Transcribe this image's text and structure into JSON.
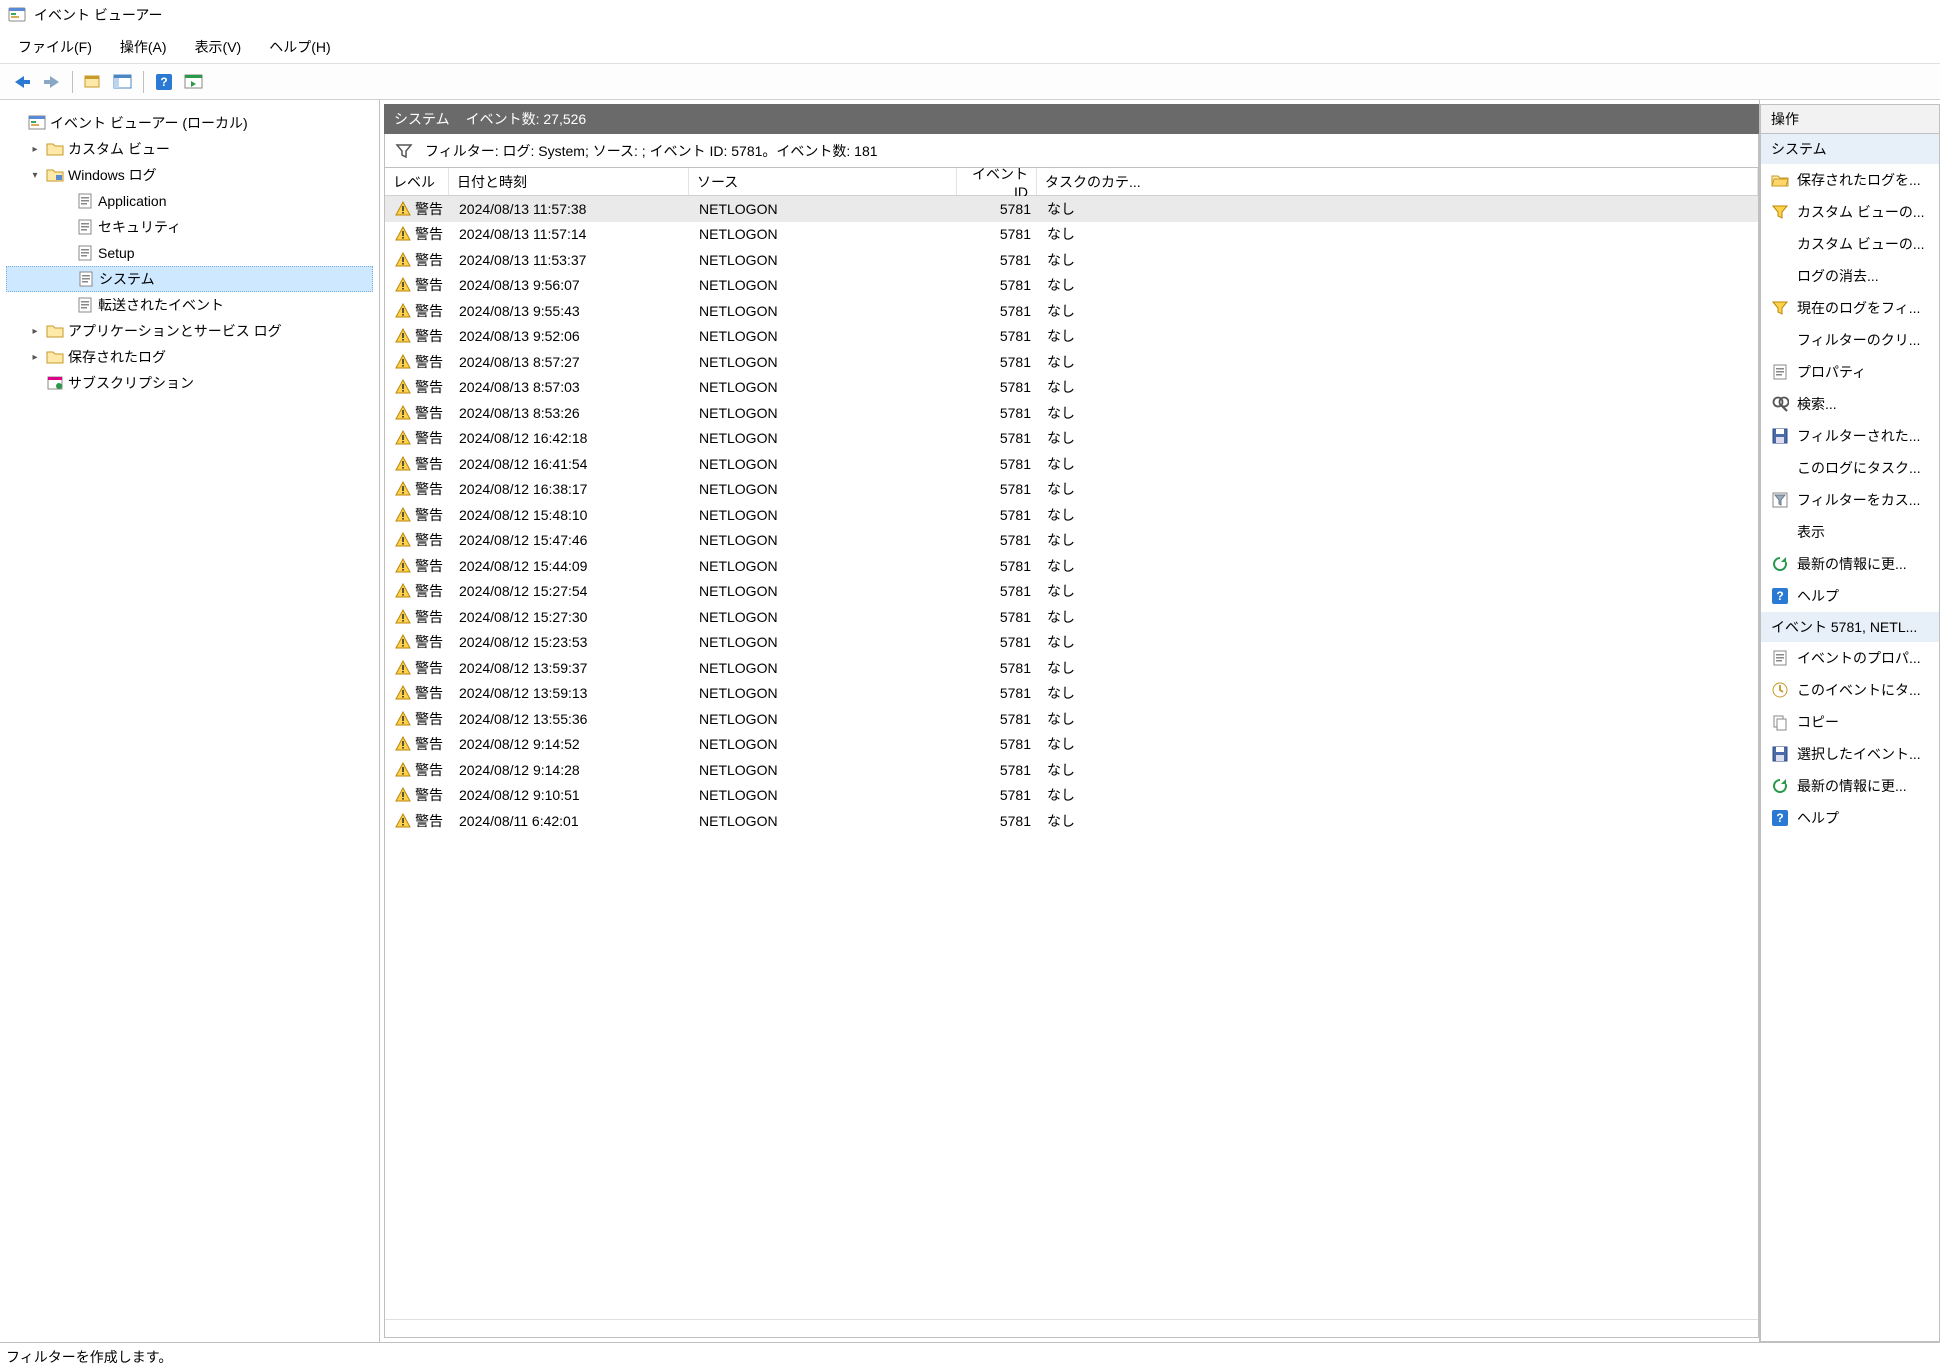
{
  "window": {
    "title": "イベント ビューアー"
  },
  "menubar": {
    "file": "ファイル(F)",
    "action": "操作(A)",
    "view": "表示(V)",
    "help": "ヘルプ(H)"
  },
  "tree": {
    "root": "イベント ビューアー (ローカル)",
    "custom_views": "カスタム ビュー",
    "windows_logs": "Windows ログ",
    "windows_children": {
      "application": "Application",
      "security": "セキュリティ",
      "setup": "Setup",
      "system": "システム",
      "forwarded": "転送されたイベント"
    },
    "app_service_logs": "アプリケーションとサービス ログ",
    "saved_logs": "保存されたログ",
    "subscriptions": "サブスクリプション"
  },
  "center": {
    "header_log": "システム",
    "header_count_label": "イベント数:",
    "header_count_value": "27,526",
    "filter_text": "フィルター: ログ: System; ソース: ; イベント ID: 5781。イベント数: 181"
  },
  "columns": {
    "level": "レベル",
    "date": "日付と時刻",
    "source": "ソース",
    "id": "イベント ID",
    "task": "タスクのカテ..."
  },
  "level_warning_label": "警告",
  "events": [
    {
      "date": "2024/08/13 11:57:38",
      "source": "NETLOGON",
      "id": "5781",
      "task": "なし",
      "selected": true
    },
    {
      "date": "2024/08/13 11:57:14",
      "source": "NETLOGON",
      "id": "5781",
      "task": "なし"
    },
    {
      "date": "2024/08/13 11:53:37",
      "source": "NETLOGON",
      "id": "5781",
      "task": "なし"
    },
    {
      "date": "2024/08/13 9:56:07",
      "source": "NETLOGON",
      "id": "5781",
      "task": "なし"
    },
    {
      "date": "2024/08/13 9:55:43",
      "source": "NETLOGON",
      "id": "5781",
      "task": "なし"
    },
    {
      "date": "2024/08/13 9:52:06",
      "source": "NETLOGON",
      "id": "5781",
      "task": "なし"
    },
    {
      "date": "2024/08/13 8:57:27",
      "source": "NETLOGON",
      "id": "5781",
      "task": "なし"
    },
    {
      "date": "2024/08/13 8:57:03",
      "source": "NETLOGON",
      "id": "5781",
      "task": "なし"
    },
    {
      "date": "2024/08/13 8:53:26",
      "source": "NETLOGON",
      "id": "5781",
      "task": "なし"
    },
    {
      "date": "2024/08/12 16:42:18",
      "source": "NETLOGON",
      "id": "5781",
      "task": "なし"
    },
    {
      "date": "2024/08/12 16:41:54",
      "source": "NETLOGON",
      "id": "5781",
      "task": "なし"
    },
    {
      "date": "2024/08/12 16:38:17",
      "source": "NETLOGON",
      "id": "5781",
      "task": "なし"
    },
    {
      "date": "2024/08/12 15:48:10",
      "source": "NETLOGON",
      "id": "5781",
      "task": "なし"
    },
    {
      "date": "2024/08/12 15:47:46",
      "source": "NETLOGON",
      "id": "5781",
      "task": "なし"
    },
    {
      "date": "2024/08/12 15:44:09",
      "source": "NETLOGON",
      "id": "5781",
      "task": "なし"
    },
    {
      "date": "2024/08/12 15:27:54",
      "source": "NETLOGON",
      "id": "5781",
      "task": "なし"
    },
    {
      "date": "2024/08/12 15:27:30",
      "source": "NETLOGON",
      "id": "5781",
      "task": "なし"
    },
    {
      "date": "2024/08/12 15:23:53",
      "source": "NETLOGON",
      "id": "5781",
      "task": "なし"
    },
    {
      "date": "2024/08/12 13:59:37",
      "source": "NETLOGON",
      "id": "5781",
      "task": "なし"
    },
    {
      "date": "2024/08/12 13:59:13",
      "source": "NETLOGON",
      "id": "5781",
      "task": "なし"
    },
    {
      "date": "2024/08/12 13:55:36",
      "source": "NETLOGON",
      "id": "5781",
      "task": "なし"
    },
    {
      "date": "2024/08/12 9:14:52",
      "source": "NETLOGON",
      "id": "5781",
      "task": "なし"
    },
    {
      "date": "2024/08/12 9:14:28",
      "source": "NETLOGON",
      "id": "5781",
      "task": "なし"
    },
    {
      "date": "2024/08/12 9:10:51",
      "source": "NETLOGON",
      "id": "5781",
      "task": "なし"
    },
    {
      "date": "2024/08/11 6:42:01",
      "source": "NETLOGON",
      "id": "5781",
      "task": "なし"
    }
  ],
  "actions": {
    "pane_title": "操作",
    "section1_title": "システム",
    "section1_items": [
      {
        "icon": "folder-open",
        "label": "保存されたログを..."
      },
      {
        "icon": "funnel",
        "label": "カスタム ビューの..."
      },
      {
        "icon": "blank",
        "label": "カスタム ビューの..."
      },
      {
        "icon": "blank",
        "label": "ログの消去..."
      },
      {
        "icon": "funnel",
        "label": "現在のログをフィ..."
      },
      {
        "icon": "blank",
        "label": "フィルターのクリ..."
      },
      {
        "icon": "properties",
        "label": "プロパティ"
      },
      {
        "icon": "search",
        "label": "検索..."
      },
      {
        "icon": "save",
        "label": "フィルターされた..."
      },
      {
        "icon": "blank",
        "label": "このログにタスク..."
      },
      {
        "icon": "custom",
        "label": "フィルターをカス..."
      },
      {
        "icon": "blank",
        "label": "表示"
      },
      {
        "icon": "refresh",
        "label": "最新の情報に更..."
      },
      {
        "icon": "help",
        "label": "ヘルプ"
      }
    ],
    "section2_title": "イベント 5781, NETL...",
    "section2_items": [
      {
        "icon": "properties",
        "label": "イベントのプロパ..."
      },
      {
        "icon": "task",
        "label": "このイベントにタ..."
      },
      {
        "icon": "copy",
        "label": "コピー"
      },
      {
        "icon": "save",
        "label": "選択したイベント..."
      },
      {
        "icon": "refresh",
        "label": "最新の情報に更..."
      },
      {
        "icon": "help",
        "label": "ヘルプ"
      }
    ]
  },
  "status": "フィルターを作成します。"
}
